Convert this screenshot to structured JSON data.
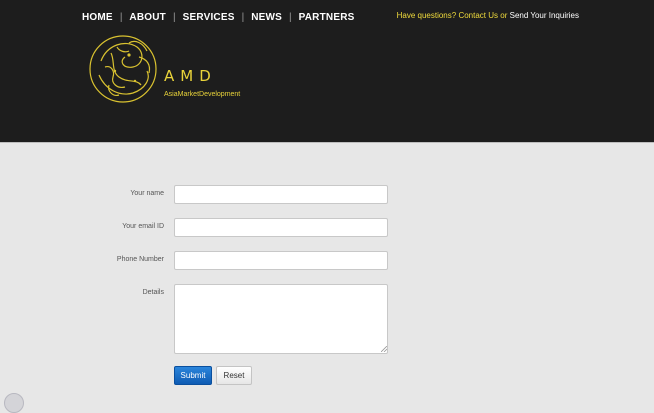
{
  "nav": {
    "items": [
      "HOME",
      "ABOUT",
      "SERVICES",
      "NEWS",
      "PARTNERS"
    ],
    "separator": "|"
  },
  "topbar": {
    "question": "Have questions?",
    "contact_link": "Contact Us",
    "or": "or",
    "inquiry_link": "Send Your Inquiries"
  },
  "logo": {
    "mark": "AMD",
    "tagline": "AsiaMarketDevelopment"
  },
  "form": {
    "name_label": "Your name",
    "email_label": "Your email ID",
    "phone_label": "Phone Number",
    "details_label": "Details",
    "name_value": "",
    "email_value": "",
    "phone_value": "",
    "details_value": ""
  },
  "buttons": {
    "submit": "Submit",
    "reset": "Reset"
  },
  "colors": {
    "header_bg": "#1d1d1d",
    "accent_yellow": "#f1dc3c",
    "submit_blue": "#0e5bb3",
    "page_bg": "#e7e7e7"
  }
}
